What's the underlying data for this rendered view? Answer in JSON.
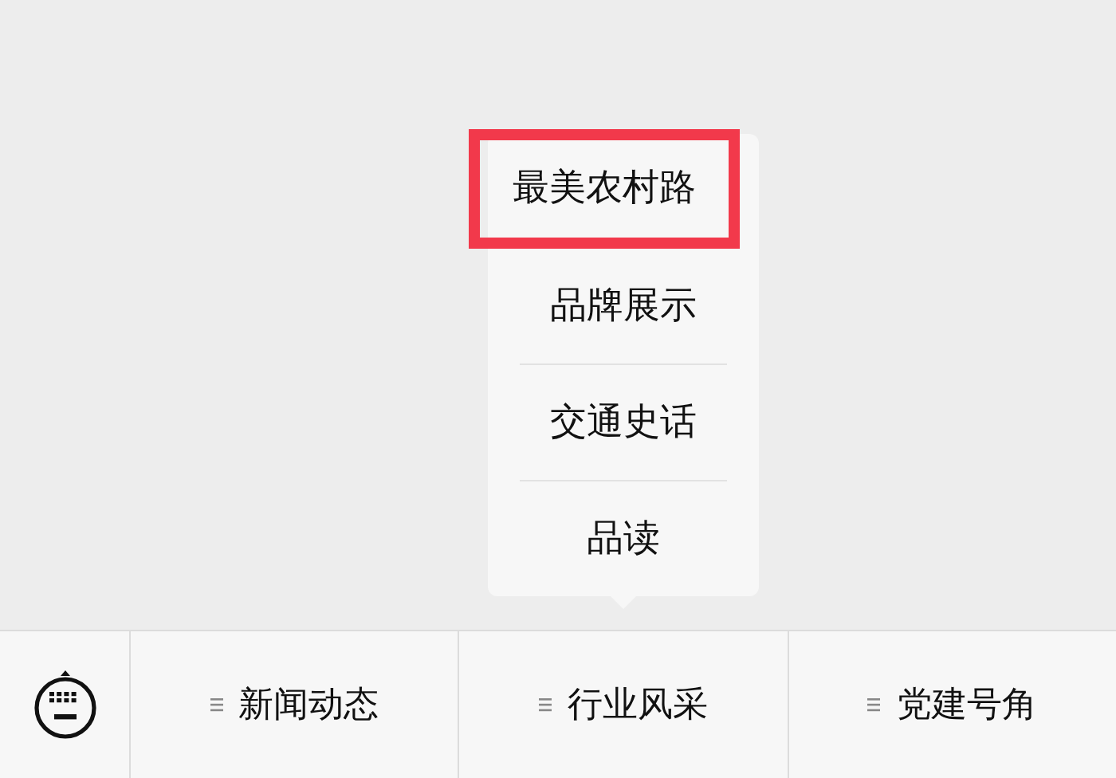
{
  "menus": [
    {
      "label": "新闻动态"
    },
    {
      "label": "行业风采",
      "submenu": [
        {
          "label": "最美农村路",
          "highlighted": true
        },
        {
          "label": "品牌展示",
          "highlighted": false
        },
        {
          "label": "交通史话",
          "highlighted": false
        },
        {
          "label": "品读",
          "highlighted": false
        }
      ]
    },
    {
      "label": "党建号角"
    }
  ]
}
